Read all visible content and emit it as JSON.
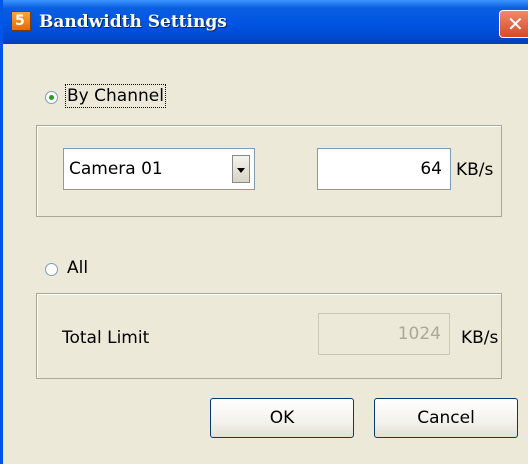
{
  "window": {
    "title": "Bandwidth Settings",
    "title_icon": "app-icon",
    "close_icon": "close-icon"
  },
  "by_channel": {
    "label": "By Channel",
    "selected": true,
    "channel_select": {
      "value": "Camera 01"
    },
    "rate_value": "64",
    "rate_unit": "KB/s"
  },
  "all": {
    "label": "All",
    "selected": false,
    "total_limit_label": "Total Limit",
    "total_limit_value": "1024",
    "total_limit_unit": "KB/s",
    "total_limit_enabled": false
  },
  "buttons": {
    "ok": "OK",
    "cancel": "Cancel"
  }
}
